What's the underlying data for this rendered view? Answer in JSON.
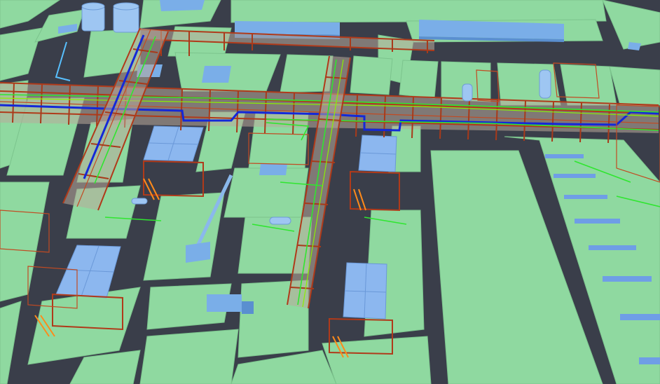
{
  "scene": {
    "kind": "3D plant model render",
    "colors": {
      "ground": "#8fd9a0",
      "road": "#3a3e4a",
      "steel": "#b03a1a",
      "equipment": "#7aaee8",
      "pipe_blue": "#1428d8",
      "pipe_green": "#2fe62f",
      "ladder": "#ff8a1a"
    },
    "objects": [
      "storage-tanks",
      "warehouse-buildings",
      "main-pipe-rack",
      "branch-pipe-racks",
      "air-cooler-structures",
      "flare-boom",
      "equipment-skids"
    ]
  }
}
